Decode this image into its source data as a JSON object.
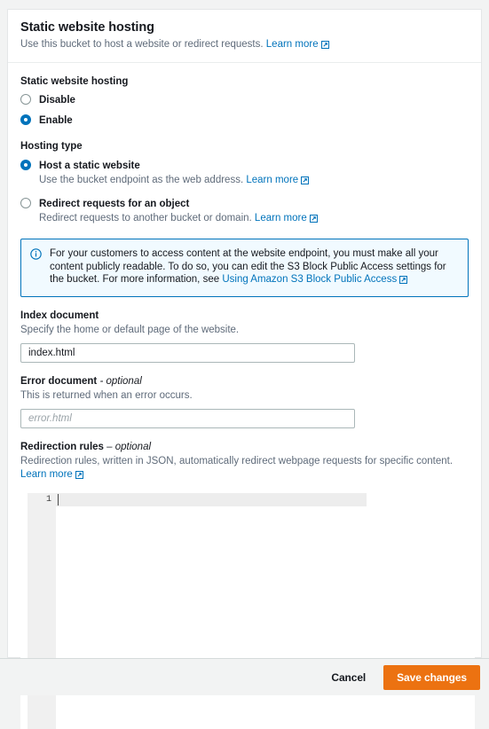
{
  "panel": {
    "title": "Static website hosting",
    "subtitle": "Use this bucket to host a website or redirect requests.",
    "subtitle_link": "Learn more"
  },
  "hosting_toggle": {
    "label": "Static website hosting",
    "options": [
      {
        "label": "Disable",
        "selected": false
      },
      {
        "label": "Enable",
        "selected": true
      }
    ]
  },
  "hosting_type": {
    "label": "Hosting type",
    "options": [
      {
        "label": "Host a static website",
        "description": "Use the bucket endpoint as the web address.",
        "link": "Learn more",
        "selected": true
      },
      {
        "label": "Redirect requests for an object",
        "description": "Redirect requests to another bucket or domain.",
        "link": "Learn more",
        "selected": false
      }
    ]
  },
  "alert": {
    "icon": "info-icon",
    "text": "For your customers to access content at the website endpoint, you must make all your content publicly readable. To do so, you can edit the S3 Block Public Access settings for the bucket. For more information, see",
    "link": "Using Amazon S3 Block Public Access"
  },
  "index_document": {
    "title": "Index document",
    "hint": "Specify the home or default page of the website.",
    "value": "index.html",
    "placeholder": ""
  },
  "error_document": {
    "title": "Error document",
    "optional_suffix": "- optional",
    "hint": "This is returned when an error occurs.",
    "value": "",
    "placeholder": "error.html"
  },
  "redirection_rules": {
    "title": "Redirection rules",
    "optional_suffix": "– optional",
    "hint": "Redirection rules, written in JSON, automatically redirect webpage requests for specific content.",
    "link": "Learn more",
    "editor": {
      "line_number": "1",
      "content": ""
    }
  },
  "footer": {
    "cancel_label": "Cancel",
    "save_label": "Save changes"
  },
  "colors": {
    "accent_blue": "#0073bb",
    "action_orange": "#ec7211",
    "alert_background": "#f1faff",
    "page_background": "#f2f3f3",
    "text_primary": "#16191f",
    "text_secondary": "#5f6b7a"
  }
}
